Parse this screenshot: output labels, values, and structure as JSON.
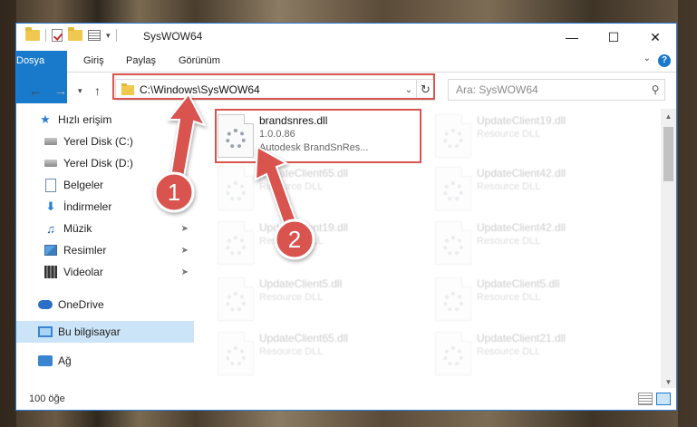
{
  "window": {
    "title": "SysWOW64"
  },
  "ribbon": {
    "tabs": [
      {
        "label": "Dosya",
        "active": true
      },
      {
        "label": "Giriş"
      },
      {
        "label": "Paylaş"
      },
      {
        "label": "Görünüm"
      }
    ],
    "help": "?"
  },
  "address": {
    "path": "C:\\Windows\\SysWOW64",
    "search_placeholder": "Ara: SysWOW64"
  },
  "sidebar": {
    "items": [
      {
        "label": "Hızlı erişim",
        "icon": "star-icon"
      },
      {
        "label": "Yerel Disk (C:)",
        "icon": "drive-icon",
        "pinned": true
      },
      {
        "label": "Yerel Disk (D:)",
        "icon": "drive-icon",
        "pinned": true
      },
      {
        "label": "Belgeler",
        "icon": "document-icon",
        "pinned": true
      },
      {
        "label": "İndirmeler",
        "icon": "download-icon",
        "pinned": true
      },
      {
        "label": "Müzik",
        "icon": "music-icon",
        "pinned": true
      },
      {
        "label": "Resimler",
        "icon": "pictures-icon",
        "pinned": true
      },
      {
        "label": "Videolar",
        "icon": "video-icon",
        "pinned": true
      },
      {
        "label": "OneDrive",
        "icon": "cloud-icon"
      },
      {
        "label": "Bu bilgisayar",
        "icon": "computer-icon",
        "selected": true
      },
      {
        "label": "Ağ",
        "icon": "network-icon"
      }
    ]
  },
  "files": [
    {
      "name": "brandsnres.dll",
      "version": "1.0.0.86",
      "desc": "Autodesk BrandSnRes...",
      "highlighted": true
    },
    {
      "name": "UpdateClient19.dll",
      "desc": "Resource DLL"
    },
    {
      "name": "UpdateClient65.dll",
      "desc": "Resource DLL"
    },
    {
      "name": "UpdateClient42.dll",
      "desc": "Resource DLL"
    },
    {
      "name": "UpdateClient19.dll",
      "desc": "Resource DLL"
    },
    {
      "name": "UpdateClient42.dll",
      "desc": "Resource DLL"
    },
    {
      "name": "UpdateClient5.dll",
      "desc": "Resource DLL"
    },
    {
      "name": "UpdateClient5.dll",
      "desc": "Resource DLL"
    },
    {
      "name": "UpdateClient65.dll",
      "desc": "Resource DLL"
    },
    {
      "name": "UpdateClient21.dll",
      "desc": "Resource DLL"
    }
  ],
  "status": {
    "count": "100 öğe"
  },
  "annotations": {
    "step1": "1",
    "step2": "2",
    "color": "#d9534f"
  }
}
